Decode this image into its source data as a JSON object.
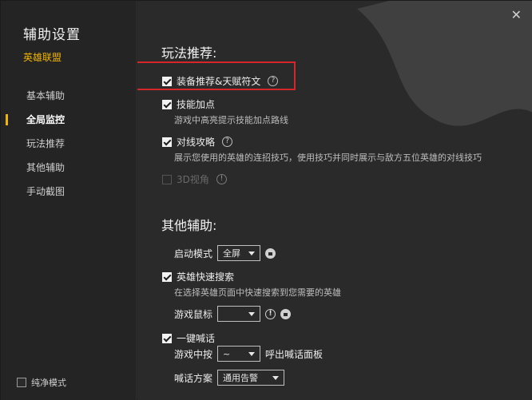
{
  "sidebar": {
    "title": "辅助设置",
    "game": "英雄联盟",
    "items": [
      {
        "label": "基本辅助",
        "active": false
      },
      {
        "label": "全局监控",
        "active": true
      },
      {
        "label": "玩法推荐",
        "active": false
      },
      {
        "label": "其他辅助",
        "active": false
      },
      {
        "label": "手动截图",
        "active": false
      }
    ],
    "pure_mode": "纯净模式"
  },
  "window": {
    "close_glyph": "✕"
  },
  "play": {
    "section_title": "玩法推荐:",
    "equip_rune": "装备推荐&天赋符文",
    "skill_points": "技能加点",
    "skill_points_desc": "游戏中高亮提示技能加点路线",
    "matchup": "对线攻略",
    "matchup_desc": "展示您使用的英雄的连招技巧，使用技巧并同时展示与敌方五位英雄的对线技巧",
    "view3d": "3D视角",
    "help_glyph": "?",
    "warn_glyph": "!"
  },
  "other": {
    "section_title": "其他辅助:",
    "launch_mode_label": "启动模式",
    "launch_mode_value": "全屏",
    "hero_search": "英雄快速搜索",
    "hero_search_desc": "在选择英雄页面中快速搜索到您需要的英雄",
    "mouse_label": "游戏鼠标",
    "mouse_value": "",
    "shout": "一键喊话",
    "shout_key_prefix": "游戏中按",
    "shout_key_value": "~",
    "shout_key_suffix": "呼出喊话面板",
    "shout_scheme_label": "喊话方案",
    "shout_scheme_value": "通用告警"
  }
}
